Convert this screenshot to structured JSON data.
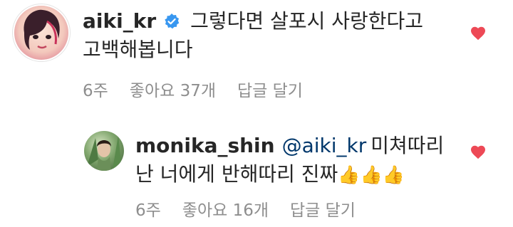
{
  "comments": [
    {
      "username": "aiki_kr",
      "verified": true,
      "text_line1": "그렇다면 살포시 사랑한다고",
      "text_line2": "고백해봅니다",
      "time": "6주",
      "likes": "좋아요 37개",
      "reply": "답글 달기"
    },
    {
      "username": "monika_shin",
      "mention": "@aiki_kr",
      "text_line1": "미쳐따리",
      "text_line2": "난 너에게 반해따리 진짜",
      "emoji": "👍👍👍",
      "time": "6주",
      "likes": "좋아요 16개",
      "reply": "답글 달기"
    }
  ],
  "colors": {
    "heart": "#ed4956",
    "verified": "#3897f0",
    "mention": "#00376b",
    "meta": "#8e8e8e",
    "text": "#262626"
  },
  "icons": [
    "verified-badge-icon",
    "heart-icon"
  ]
}
